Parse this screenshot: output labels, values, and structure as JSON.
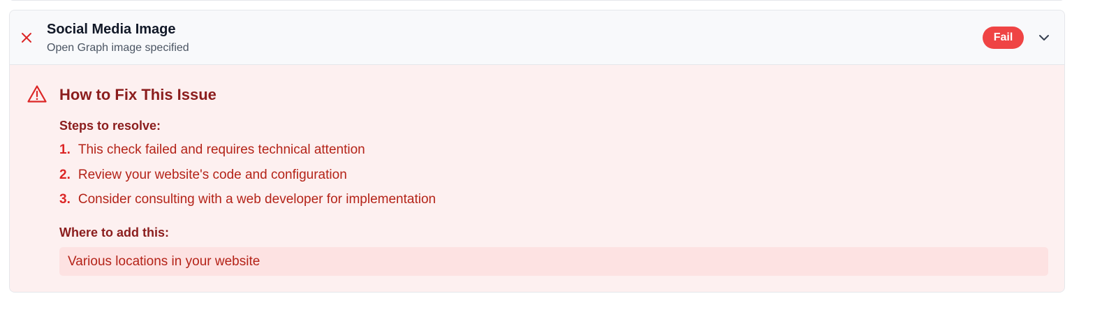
{
  "check": {
    "title": "Social Media Image",
    "subtitle": "Open Graph image specified",
    "status_label": "Fail",
    "status_icon": "x-icon",
    "expand_icon": "chevron-down-icon"
  },
  "fix": {
    "icon": "warning-triangle-icon",
    "title": "How to Fix This Issue",
    "steps_label": "Steps to resolve:",
    "steps": [
      {
        "number": "1.",
        "text": "This check failed and requires technical attention"
      },
      {
        "number": "2.",
        "text": "Review your website's code and configuration"
      },
      {
        "number": "3.",
        "text": "Consider consulting with a web developer for implementation"
      }
    ],
    "where_label": "Where to add this:",
    "location": "Various locations in your website"
  },
  "colors": {
    "fail_badge": "#ef4444",
    "fail_icon": "#dc2626",
    "panel_bg": "#fdf0f0",
    "heading_text": "#8b1d1d",
    "body_text": "#b42318",
    "location_bg": "#fde2e2"
  }
}
